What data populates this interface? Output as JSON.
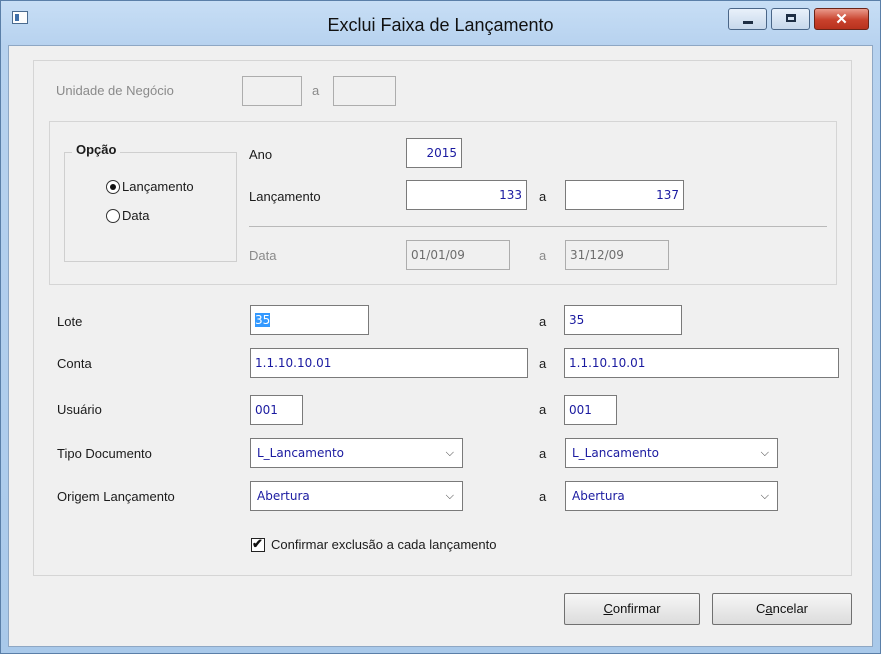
{
  "window": {
    "title": "Exclui Faixa de Lançamento"
  },
  "form": {
    "unidade": {
      "label": "Unidade de Negócio",
      "from": "",
      "sep": "a",
      "to": ""
    },
    "opcao": {
      "title": "Opção",
      "options": [
        "Lançamento",
        "Data"
      ],
      "selected": "Lançamento"
    },
    "ano": {
      "label": "Ano",
      "value": "2015"
    },
    "lancamento": {
      "label": "Lançamento",
      "from": "133",
      "sep": "a",
      "to": "137"
    },
    "data": {
      "label": "Data",
      "from": "01/01/09",
      "sep": "a",
      "to": "31/12/09"
    },
    "lote": {
      "label": "Lote",
      "from": "35",
      "sep": "a",
      "to": "35"
    },
    "conta": {
      "label": "Conta",
      "from": "1.1.10.10.01",
      "sep": "a",
      "to": "1.1.10.10.01"
    },
    "usuario": {
      "label": "Usuário",
      "from": "001",
      "sep": "a",
      "to": "001"
    },
    "tipo_documento": {
      "label": "Tipo Documento",
      "from": "L_Lancamento",
      "sep": "a",
      "to": "L_Lancamento"
    },
    "origem": {
      "label": "Origem Lançamento",
      "from": "Abertura",
      "sep": "a",
      "to": "Abertura"
    },
    "confirmar_check": {
      "label": "Confirmar exclusão a cada lançamento",
      "checked": true
    }
  },
  "buttons": {
    "confirmar": {
      "first": "C",
      "rest": "onfirmar"
    },
    "cancelar": {
      "first": "C",
      "second": "a",
      "rest": "ncelar"
    }
  },
  "icons": {
    "minimize": "minimize-icon",
    "maximize": "maximize-icon",
    "close": "close-icon",
    "dropdown": "chevron-down-icon",
    "check": "checkmark-icon"
  }
}
